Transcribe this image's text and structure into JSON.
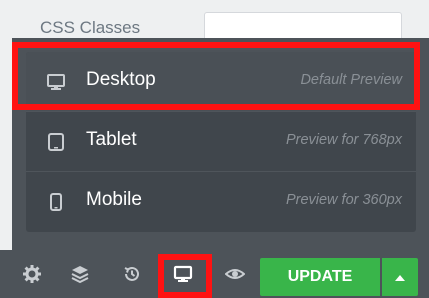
{
  "background": {
    "css_classes_label": "CSS Classes"
  },
  "devices": [
    {
      "name": "Desktop",
      "description": "Default Preview",
      "icon": "desktop-icon",
      "active": true
    },
    {
      "name": "Tablet",
      "description": "Preview for 768px",
      "icon": "tablet-icon",
      "active": false
    },
    {
      "name": "Mobile",
      "description": "Preview for 360px",
      "icon": "mobile-icon",
      "active": false
    }
  ],
  "toolbar": {
    "icons": [
      "settings-icon",
      "navigator-icon",
      "history-icon",
      "responsive-mode-icon",
      "preview-icon"
    ],
    "update_label": "UPDATE",
    "update_color": "#39b54a"
  },
  "colors": {
    "panel_dark": "#4d5359",
    "highlight": "#ff1212"
  }
}
